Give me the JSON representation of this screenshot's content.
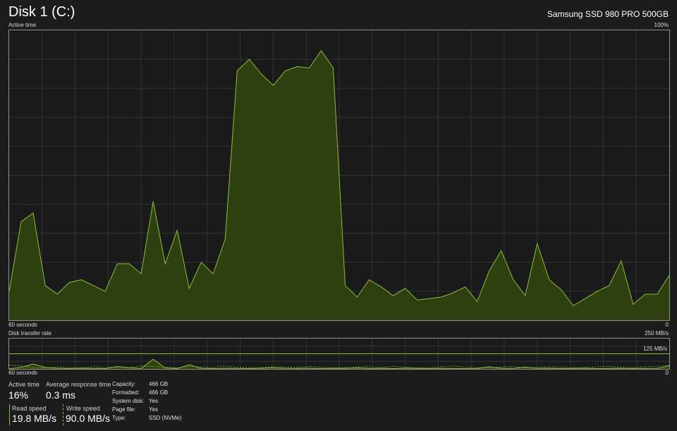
{
  "header": {
    "title": "Disk 1 (C:)",
    "model": "Samsung SSD 980 PRO 500GB"
  },
  "active_chart": {
    "label": "Active time",
    "max_label": "100%",
    "left_bottom": "60 seconds",
    "right_bottom": "0"
  },
  "transfer_chart": {
    "label": "Disk transfer rate",
    "max_label": "250 MB/s",
    "mid_label": "125 MB/s",
    "left_bottom": "60 seconds",
    "right_bottom": "0"
  },
  "metrics": {
    "active_time": {
      "label": "Active time",
      "value": "16%"
    },
    "response_time": {
      "label": "Average response time",
      "value": "0.3 ms"
    },
    "read_speed": {
      "label": "Read speed",
      "value": "19.8 MB/s"
    },
    "write_speed": {
      "label": "Write speed",
      "value": "90.0 MB/s"
    }
  },
  "details": [
    {
      "label": "Capacity:",
      "value": "466 GB"
    },
    {
      "label": "Formatted:",
      "value": "466 GB"
    },
    {
      "label": "System disk:",
      "value": "Yes"
    },
    {
      "label": "Page file:",
      "value": "Yes"
    },
    {
      "label": "Type:",
      "value": "SSD (NVMe)"
    }
  ],
  "colors": {
    "accent": "#8cbd3a",
    "fill": "#2f4010",
    "grid": "#333333",
    "border": "#8e8e8e"
  },
  "chart_data": [
    {
      "type": "area",
      "title": "Active time",
      "ylim": [
        0,
        100
      ],
      "x_range_seconds": [
        60,
        0
      ],
      "values": [
        10,
        34,
        37,
        12,
        9,
        13,
        14,
        12,
        10,
        19.5,
        19.5,
        16,
        41,
        19.5,
        31,
        11,
        20,
        16,
        28,
        86,
        90,
        85,
        81,
        86,
        87.5,
        87,
        93,
        87,
        12,
        8,
        14,
        11.5,
        8.5,
        11,
        7,
        7.5,
        8,
        9.5,
        11.5,
        6.5,
        17,
        24,
        14,
        8.5,
        26.5,
        14,
        10.5,
        5,
        7.5,
        10,
        12,
        20.5,
        5.5,
        9,
        9,
        15.5
      ]
    },
    {
      "type": "line",
      "title": "Disk transfer rate",
      "ylim": [
        0,
        250
      ],
      "series": [
        {
          "name": "Read speed",
          "values": [
            2,
            14,
            40,
            12,
            5,
            3,
            6,
            4,
            3,
            20,
            10,
            4,
            80,
            8,
            3,
            35,
            5,
            3,
            6,
            4,
            3,
            6,
            10,
            5,
            4,
            6,
            3,
            5,
            4,
            8,
            4,
            5,
            3,
            6,
            4,
            3,
            5,
            4,
            3,
            4,
            18,
            5,
            4,
            15,
            4,
            6,
            3,
            4,
            5,
            3,
            4,
            5,
            3,
            4,
            5,
            25
          ]
        },
        {
          "name": "Write speed",
          "values": [
            30,
            25,
            10,
            8,
            15,
            12,
            10,
            18,
            12,
            15,
            10,
            25,
            20,
            15,
            10,
            20,
            15,
            12,
            25,
            15,
            12,
            10,
            18,
            15,
            12,
            20,
            15,
            10,
            12,
            15,
            18,
            12,
            20,
            15,
            10,
            12,
            18,
            25,
            15,
            10,
            12,
            15,
            20,
            10,
            12,
            18,
            15,
            10,
            12,
            18,
            20,
            15,
            12,
            18,
            20,
            30
          ]
        }
      ]
    }
  ]
}
